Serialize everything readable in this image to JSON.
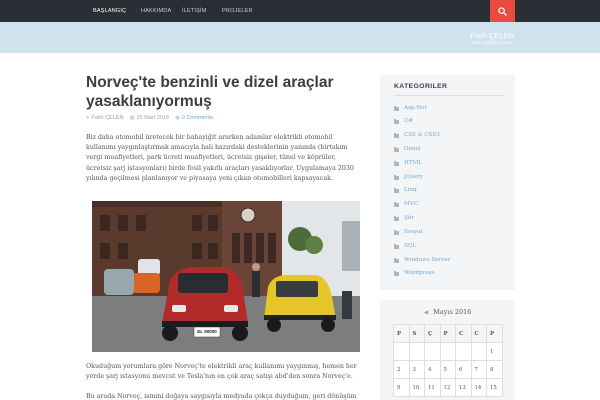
{
  "nav": {
    "items": [
      "BAŞLANGIÇ",
      "HAKKIMDA",
      "İLETİŞİM",
      "PROJELER"
    ]
  },
  "header": {
    "title": "Fatih ÇELEN",
    "tagline": "Biraz değinle katsın."
  },
  "post": {
    "title": "Norveç'te benzinli ve dizel araçlar yasaklanıyormuş",
    "author": "Fatih ÇELEN",
    "date": "25 Mart 2016",
    "comments": "0 Comments",
    "paragraph1": "Biz daha otomobil üretecek bir babayiğit ararken adamlar elektrikli otomobil kullanımı yaygınlaştırmak amacıyla hali hazırdaki desteklerinin yanında (birtakım vergi muafiyetleri, park ücreti muafiyetleri, ücretsiz gişeler, tünel ve köprüler, ücretsiz şarj istasyonları) birde fosil yakıtlı araçları yasaklıyorlar. Uygulamaya 2030 yılında geçilmesi planlanıyor ve piyasaya yeni çıkan otomobilleri kapsayacak.",
    "paragraph2": "Okuduğum yorumlara göre Norveç'te elektrikli araç kullanımı yaygınmış, hemen her yerde şarj istasyonu mevcut ve Tesla'nın en çok araç satışı abd'den sonra Norveç'e.",
    "paragraph3": "Bu arada Norveç, ismini doğaya saygısıyla medyada çokça duyduğum, geri dönüşüm",
    "plate": "EL 90000"
  },
  "sidebar": {
    "categories_title": "KATEGORILER",
    "categories": [
      "Asp.Net",
      "C#",
      "CSS & CSS3",
      "Genel",
      "HTML",
      "jQuery",
      "Linq",
      "MVC",
      "Şiir",
      "Sosyal",
      "SQL",
      "Windows Server",
      "Wordpress"
    ],
    "calendar": {
      "month": "Mayıs 2016",
      "days": [
        "P",
        "S",
        "Ç",
        "P",
        "C",
        "C",
        "P"
      ],
      "weeks": [
        [
          "",
          "",
          "",
          "",
          "",
          "",
          "1"
        ],
        [
          "2",
          "3",
          "4",
          "5",
          "6",
          "7",
          "8"
        ],
        [
          "9",
          "10",
          "11",
          "12",
          "13",
          "14",
          "15"
        ]
      ]
    }
  },
  "colors": {
    "nav_bg": "#2b2e35",
    "header_bg": "#cfe3ee",
    "accent_red": "#e74c3c",
    "link_blue": "#6ca9d6"
  }
}
